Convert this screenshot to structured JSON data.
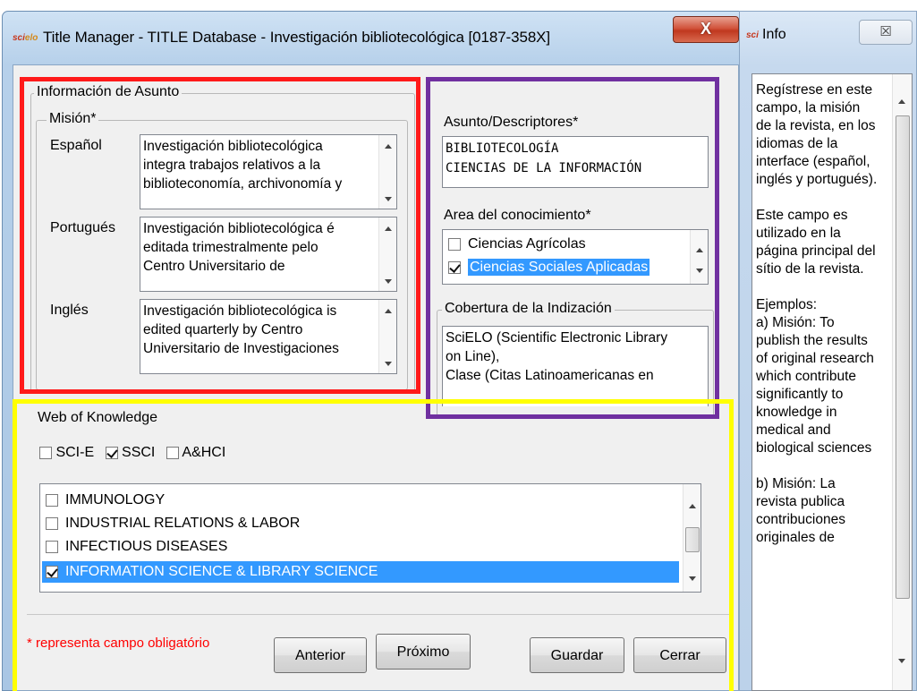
{
  "main_window": {
    "title": "Title Manager - TITLE Database - Investigación bibliotecológica [0187-358X]",
    "logo_text": "scielo",
    "close_label": "X"
  },
  "subject_info": {
    "group_label": "Información de Asunto",
    "mission_label": "Misión*",
    "spanish_label": "Español",
    "spanish_text": "Investigación bibliotecológica\nintegra trabajos relativos a la\nbiblioteconomía, archivonomía y",
    "portuguese_label": "Portugués",
    "portuguese_text": "Investigación bibliotecológica é\neditada trimestralmente pelo\nCentro Universitario de",
    "english_label": "Inglés",
    "english_text": "Investigación bibliotecológica is\nedited quarterly by Centro\nUniversitario de Investigaciones"
  },
  "descriptors": {
    "label": "Asunto/Descriptores*",
    "value": "BIBLIOTECOLOGÍA\nCIENCIAS DE LA INFORMACIÓN"
  },
  "knowledge_area": {
    "label": "Area del conocimiento*",
    "items": [
      {
        "label": "Ciencias Agrícolas",
        "checked": false,
        "selected": false
      },
      {
        "label": "Ciencias Sociales Aplicadas",
        "checked": true,
        "selected": true
      }
    ]
  },
  "index_coverage": {
    "label": "Cobertura de la Indización",
    "value": "SciELO (Scientific Electronic Library\non Line),\nClase (Citas Latinoamericanas en"
  },
  "web_of_knowledge": {
    "label": "Web of Knowledge",
    "options": [
      {
        "label": "SCI-E",
        "checked": false
      },
      {
        "label": "SSCI",
        "checked": true
      },
      {
        "label": "A&HCI",
        "checked": false
      }
    ],
    "categories": [
      {
        "label": "IMMUNOLOGY",
        "checked": false,
        "selected": false
      },
      {
        "label": "INDUSTRIAL RELATIONS & LABOR",
        "checked": false,
        "selected": false
      },
      {
        "label": "INFECTIOUS DISEASES",
        "checked": false,
        "selected": false
      },
      {
        "label": "INFORMATION SCIENCE & LIBRARY SCIENCE",
        "checked": true,
        "selected": true
      }
    ]
  },
  "footer": {
    "required_note": "* representa campo obligatório",
    "previous_label": "Anterior",
    "next_label": "Próximo",
    "save_label": "Guardar",
    "close_label": "Cerrar"
  },
  "info_window": {
    "title": "Info",
    "close_label": "☒",
    "text": "Regístrese en este\ncampo, la misión\nde la revista, en los\nidiomas de la\ninterface (español,\ninglés y portugués).\n\nEste campo es\nutilizado en la\npágina principal del\nsítio de la revista.\n\nEjemplos:\n   a) Misión: To\npublish the results\nof original research\nwhich contribute\nsignificantly to\nknowledge in\nmedical and\nbiological sciences\n\n   b) Misión: La\nrevista publica\ncontribuciones\noriginales de"
  },
  "colors": {
    "annotation_red": "#ff1a1a",
    "annotation_purple": "#7030a0",
    "annotation_yellow": "#ffff00",
    "selection_blue": "#3399ff",
    "required_red": "#ff0000"
  }
}
